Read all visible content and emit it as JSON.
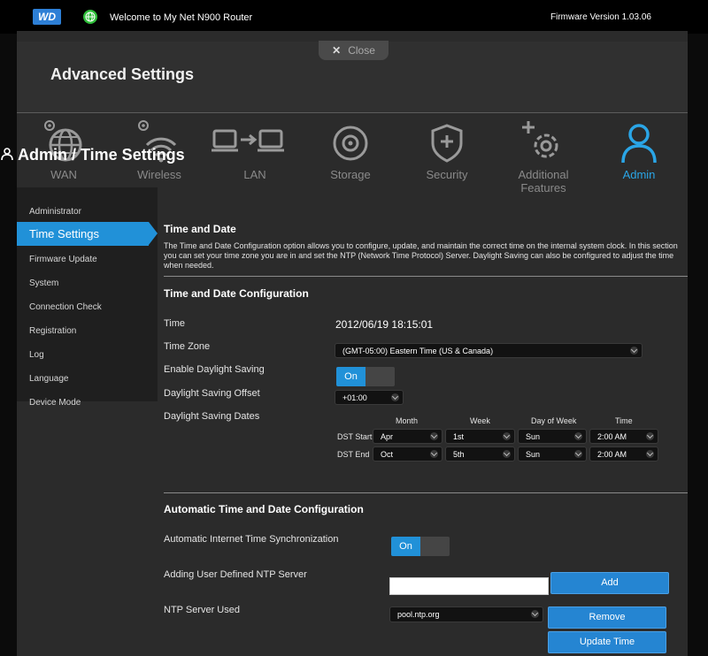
{
  "header": {
    "logo_text": "WD",
    "welcome": "Welcome to My Net N900 Router",
    "firmware": "Firmware Version 1.03.06"
  },
  "panel": {
    "title": "Advanced Settings",
    "close_label": "Close"
  },
  "nav": {
    "items": [
      {
        "label": "WAN",
        "icon": "globe-gear-icon"
      },
      {
        "label": "Wireless",
        "icon": "wifi-gear-icon"
      },
      {
        "label": "LAN",
        "icon": "lan-computers-icon"
      },
      {
        "label": "Storage",
        "icon": "disk-icon"
      },
      {
        "label": "Security",
        "icon": "shield-plus-icon"
      },
      {
        "label": "Additional Features",
        "icon": "gear-plus-icon"
      },
      {
        "label": "Admin",
        "icon": "person-icon"
      }
    ],
    "active": "Admin",
    "accent_color": "#2aa5e6"
  },
  "page_title": "Admin / Time Settings",
  "sidebar": {
    "items": [
      "Administrator",
      "Time Settings",
      "Firmware Update",
      "System",
      "Connection Check",
      "Registration",
      "Log",
      "Language",
      "Device Mode"
    ],
    "active": "Time Settings"
  },
  "time_and_date": {
    "heading": "Time and Date",
    "description": "The Time and Date Configuration option allows you to configure, update, and maintain the correct time on the internal system clock. In this section you can set your time zone you are in and set the NTP (Network Time Protocol) Server. Daylight Saving can also be configured to adjust the time when needed."
  },
  "config": {
    "heading": "Time and Date Configuration",
    "time_label": "Time",
    "time_value": "2012/06/19 18:15:01",
    "timezone_label": "Time Zone",
    "timezone_value": "(GMT-05:00) Eastern Time (US & Canada)",
    "dst_label": "Enable Daylight Saving",
    "dst_toggle": "On",
    "offset_label": "Daylight Saving Offset",
    "offset_value": "+01:00",
    "dates_label": "Daylight Saving Dates",
    "columns": [
      "Month",
      "Week",
      "Day of Week",
      "Time"
    ],
    "rows": [
      {
        "label": "DST Start",
        "month": "Apr",
        "week": "1st",
        "day": "Sun",
        "time": "2:00 AM"
      },
      {
        "label": "DST End",
        "month": "Oct",
        "week": "5th",
        "day": "Sun",
        "time": "2:00 AM"
      }
    ]
  },
  "auto": {
    "heading": "Automatic Time and Date Configuration",
    "sync_label": "Automatic Internet Time Synchronization",
    "sync_toggle": "On",
    "ntp_add_label": "Adding User Defined NTP Server",
    "ntp_add_value": "",
    "add_button": "Add",
    "ntp_used_label": "NTP Server Used",
    "ntp_used_value": "pool.ntp.org",
    "remove_button": "Remove",
    "update_button": "Update Time"
  }
}
